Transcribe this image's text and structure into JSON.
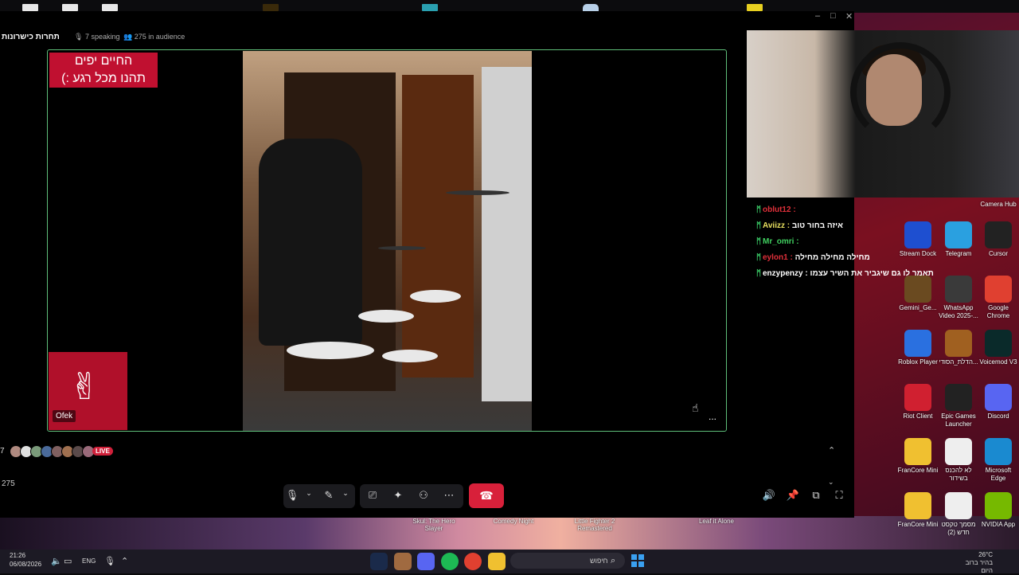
{
  "window": {
    "channel_name": "תחרות כישרונות",
    "speaking": "7 speaking",
    "audience": "275 in audience",
    "controls": {
      "minimize": "–",
      "maximize": "□",
      "close": "✕"
    }
  },
  "stage": {
    "overlay_line1": "החיים יפים",
    "overlay_line2": "תהנו מכל רגע :)",
    "speaker_name": "Ofek",
    "more": "..."
  },
  "audience_bar": {
    "count": "7",
    "live_label": "LIVE",
    "total": "275",
    "avatar_colors": [
      "#b08a80",
      "#e0e0e0",
      "#7a9a7a",
      "#4a6a9a",
      "#806060",
      "#a07050",
      "#5a4a4a",
      "#9a6a7a"
    ]
  },
  "chat": [
    {
      "user": "oblut12",
      "user_color": "#e0303a",
      "message": ""
    },
    {
      "user": "Aviizz",
      "user_color": "#e8e060",
      "message": "איזה בחור טוב"
    },
    {
      "user": "Mr_omri",
      "user_color": "#40d060",
      "message": ""
    },
    {
      "user": "eylon1",
      "user_color": "#e0303a",
      "message": "מחילה מחילה מחילה"
    },
    {
      "user": "enzypenzy",
      "user_color": "#ffffff",
      "message": "תאמר לו גם שיגביר את השיר עצמו"
    }
  ],
  "desktop_icons": [
    {
      "label": "Camera Hub",
      "color": "#333"
    },
    {
      "label": "Stream Dock",
      "color": "#1e4fd0"
    },
    {
      "label": "Telegram",
      "color": "#2aa0e0"
    },
    {
      "label": "Cursor",
      "color": "#222"
    },
    {
      "label": "Gemini_Ge...",
      "color": "#6a4a20"
    },
    {
      "label": "WhatsApp Video 2025-...",
      "color": "#3a3a3a"
    },
    {
      "label": "Google Chrome",
      "color": "#e04030"
    },
    {
      "label": "Roblox Player",
      "color": "#2a70e0"
    },
    {
      "label": "הדלת_הסודי...",
      "color": "#a06020"
    },
    {
      "label": "Voicemod V3",
      "color": "#0a2a2a"
    },
    {
      "label": "Riot Client",
      "color": "#d02030"
    },
    {
      "label": "Epic Games Launcher",
      "color": "#222"
    },
    {
      "label": "Discord",
      "color": "#5865f2"
    },
    {
      "label": "FranCore Mini",
      "color": "#f0c030"
    },
    {
      "label": "לא להכנס בשידור",
      "color": "#eee"
    },
    {
      "label": "Microsoft Edge",
      "color": "#1a8ad0"
    },
    {
      "label": "FranCore Mini",
      "color": "#f0c030"
    },
    {
      "label": "מסמך טקסט חדש (2)",
      "color": "#eee"
    },
    {
      "label": "NVIDIA App",
      "color": "#76b900"
    }
  ],
  "wallpaper_games": [
    "Skul: The Hero Slayer",
    "Comedy Night",
    "Little Fighter 2 Remastered",
    "Leaf it Alone"
  ],
  "taskbar": {
    "time": "21:26",
    "date": "06/08/2026",
    "language": "ENG",
    "search_label": "חיפוש",
    "weather_temp": "26°C",
    "weather_desc": "בהיר ברוב היום"
  }
}
